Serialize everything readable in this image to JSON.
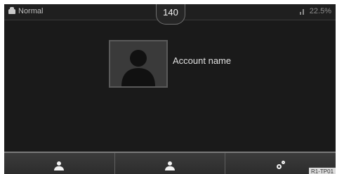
{
  "status": {
    "mode_label": "Normal",
    "time": "140",
    "battery": "22.5%",
    "signal_indicator": "ll"
  },
  "account": {
    "name": "Account name",
    "avatar_icon": "person-silhouette-icon"
  },
  "bottom_bar": [
    {
      "icon": "person-icon"
    },
    {
      "icon": "person-icon"
    },
    {
      "icon": "person-key-icon"
    }
  ],
  "badge": "R1-TP01"
}
